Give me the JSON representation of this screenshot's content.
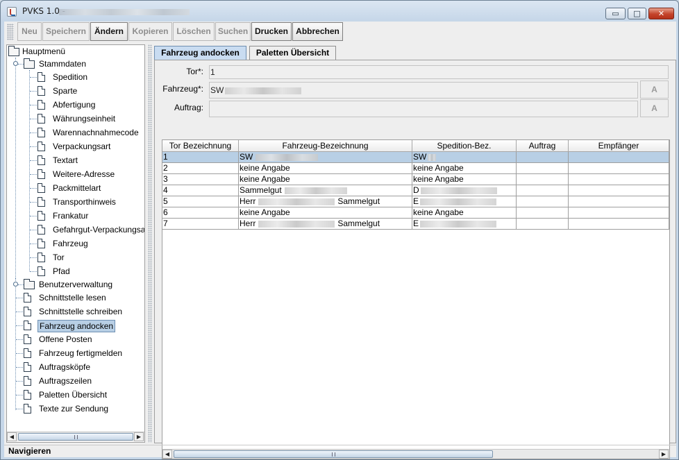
{
  "window": {
    "title": "PVKS 1.0 -",
    "buttons": {
      "minimize": "▭",
      "maximize": "□",
      "close": "✕"
    }
  },
  "toolbar": {
    "buttons": [
      {
        "label": "Neu",
        "enabled": false
      },
      {
        "label": "Speichern",
        "enabled": false
      },
      {
        "label": "Ändern",
        "enabled": true
      },
      {
        "label": "Kopieren",
        "enabled": false
      },
      {
        "label": "Löschen",
        "enabled": false
      },
      {
        "label": "Suchen",
        "enabled": false
      },
      {
        "label": "Drucken",
        "enabled": true
      },
      {
        "label": "Abbrechen",
        "enabled": true
      }
    ]
  },
  "tree": {
    "root": "Hauptmenü",
    "stammdaten": {
      "label": "Stammdaten",
      "items": [
        "Spedition",
        "Sparte",
        "Abfertigung",
        "Währungseinheit",
        "Warennachnahmecode",
        "Verpackungsart",
        "Textart",
        "Weitere-Adresse",
        "Packmittelart",
        "Transporthinweis",
        "Frankatur",
        "Gefahrgut-Verpackungsa",
        "Fahrzeug",
        "Tor",
        "Pfad"
      ]
    },
    "benutzerverwaltung": "Benutzerverwaltung",
    "items": [
      "Schnittstelle lesen",
      "Schnittstelle schreiben",
      "Fahrzeug andocken",
      "Offene Posten",
      "Fahrzeug fertigmelden",
      "Auftragsköpfe",
      "Auftragszeilen",
      "Paletten Übersicht",
      "Texte zur Sendung"
    ],
    "selected": "Fahrzeug andocken"
  },
  "tabs": [
    {
      "label": "Fahrzeug andocken",
      "active": true
    },
    {
      "label": "Paletten Übersicht",
      "active": false
    }
  ],
  "form": {
    "tor_label": "Tor*:",
    "tor_value": "1",
    "fahrzeug_label": "Fahrzeug*:",
    "fahrzeug_value": "SW",
    "auftrag_label": "Auftrag:",
    "auftrag_value": "",
    "lookup_button": "A"
  },
  "table": {
    "columns": [
      "Tor Bezeichnung",
      "Fahrzeug-Bezeichnung",
      "Spedition-Bez.",
      "Auftrag",
      "Empfänger"
    ],
    "rows": [
      {
        "tor": "1",
        "fahrzeug": "SW",
        "spedition": "SW",
        "auftrag": "",
        "empfaenger": "",
        "selected": true
      },
      {
        "tor": "2",
        "fahrzeug": "keine Angabe",
        "spedition": "keine Angabe",
        "auftrag": "",
        "empfaenger": ""
      },
      {
        "tor": "3",
        "fahrzeug": "keine Angabe",
        "spedition": "keine Angabe",
        "auftrag": "",
        "empfaenger": ""
      },
      {
        "tor": "4",
        "fahrzeug": "Sammelgut",
        "spedition": "D",
        "auftrag": "",
        "empfaenger": ""
      },
      {
        "tor": "5",
        "fahrzeug": "Herr",
        "fahrzeug_suffix": "Sammelgut",
        "spedition": "E",
        "auftrag": "",
        "empfaenger": ""
      },
      {
        "tor": "6",
        "fahrzeug": "keine Angabe",
        "spedition": "keine Angabe",
        "auftrag": "",
        "empfaenger": ""
      },
      {
        "tor": "7",
        "fahrzeug": "Herr",
        "fahrzeug_suffix": "Sammelgut",
        "spedition": "E",
        "auftrag": "",
        "empfaenger": ""
      }
    ]
  },
  "status": {
    "text": "Navigieren"
  },
  "scroll": {
    "left": "◀",
    "right": "▶"
  }
}
